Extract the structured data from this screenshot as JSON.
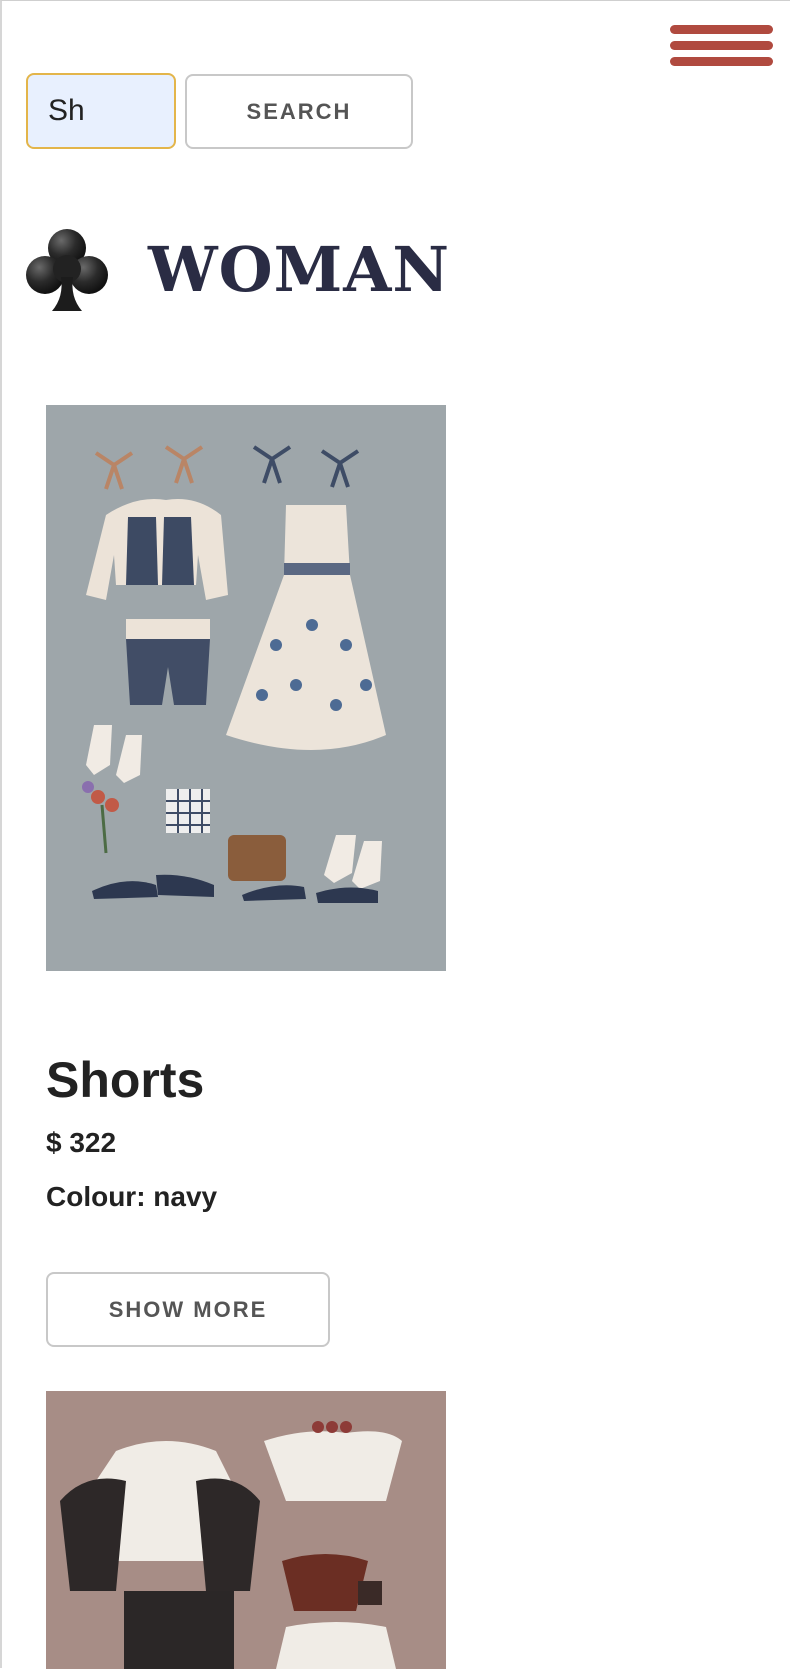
{
  "header": {
    "menu_icon": "hamburger-icon",
    "menu_color": "#b04a3f"
  },
  "search": {
    "value": "Sh",
    "button_label": "SEARCH"
  },
  "category": {
    "icon": "club-suit-icon",
    "title": "WOMAN"
  },
  "products": [
    {
      "name": "Shorts",
      "price": "$ 322",
      "colour": "Colour: navy",
      "button_label": "SHOW MORE",
      "image": "outfit-illustration-grey"
    },
    {
      "image": "outfit-illustration-mauve"
    }
  ]
}
